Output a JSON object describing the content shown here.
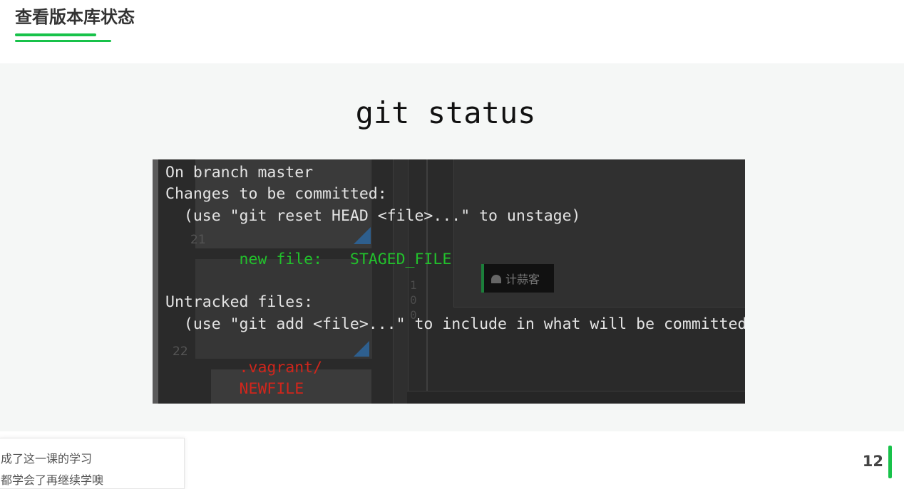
{
  "header": {
    "title": "查看版本库状态"
  },
  "slide": {
    "heading": "git status",
    "terminal": {
      "lines": [
        {
          "text": "On branch master",
          "color": "#e4e4e4"
        },
        {
          "text": "Changes to be committed:",
          "color": "#e4e4e4"
        },
        {
          "text": "  (use \"git reset HEAD <file>...\" to unstage)",
          "color": "#e4e4e4"
        },
        {
          "text": "",
          "color": "#e4e4e4"
        },
        {
          "text": "        new file:   STAGED_FILE",
          "color": "#22c12c"
        },
        {
          "text": "",
          "color": "#e4e4e4"
        },
        {
          "text": "Untracked files:",
          "color": "#e4e4e4"
        },
        {
          "text": "  (use \"git add <file>...\" to include in what will be committed)",
          "color": "#e4e4e4"
        },
        {
          "text": "",
          "color": "#e4e4e4"
        },
        {
          "text": "        .vagrant/",
          "color": "#d0261c"
        },
        {
          "text": "        NEWFILE",
          "color": "#d0261c"
        }
      ],
      "background_numbers": [
        "21",
        "22"
      ],
      "background_digits": [
        "1",
        "0",
        "0"
      ],
      "watermark_text": "计蒜客",
      "watermark_icon": "jisuanke-logo-icon"
    }
  },
  "chat": {
    "line1": "成了这一课的学习",
    "line2": "都学会了再继续学噢"
  },
  "pagination": {
    "current_page": "12"
  },
  "colors": {
    "accent": "#18c24a",
    "terminal_bg": "#2a2a2a",
    "staged": "#22c12c",
    "untracked": "#d0261c"
  }
}
